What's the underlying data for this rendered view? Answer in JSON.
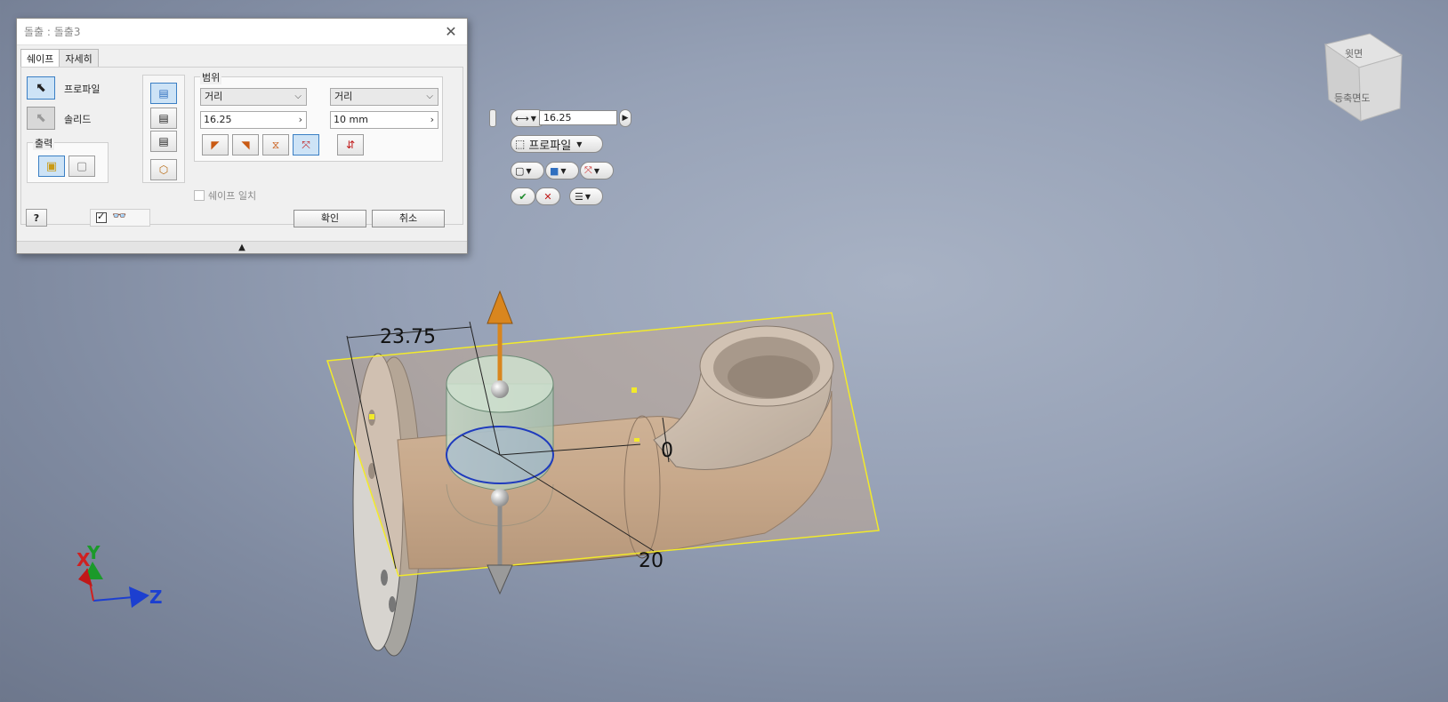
{
  "dialog": {
    "title": "돌출 : 돌출3",
    "tabs": [
      "쉐이프",
      "자세히"
    ],
    "shape": {
      "profile_label": "프로파일",
      "solid_label": "솔리드",
      "output_title": "출력"
    },
    "extents": {
      "title": "범위",
      "dir1_type": "거리",
      "dir2_type": "거리",
      "dir1_value": "16.25",
      "dir2_value": "10 mm",
      "match_shape_label": "쉐이프 일치"
    },
    "ok_label": "확인",
    "cancel_label": "취소"
  },
  "mini_toolbar": {
    "distance_value": "16.25",
    "profile_label": "프로파일"
  },
  "viewport": {
    "dim_width": "23.75",
    "dim_zero": "0",
    "dim_twenty": "20",
    "axis_x": "X",
    "axis_y": "Y",
    "axis_z": "Z",
    "viewcube_face": "등축면도",
    "viewcube_top": "윗면"
  },
  "colors": {
    "accent": "#3b7fc4",
    "gizmo_up": "#d9861e",
    "sketch_plane": "#f2ea2a",
    "part_body": "#c7a98c"
  }
}
